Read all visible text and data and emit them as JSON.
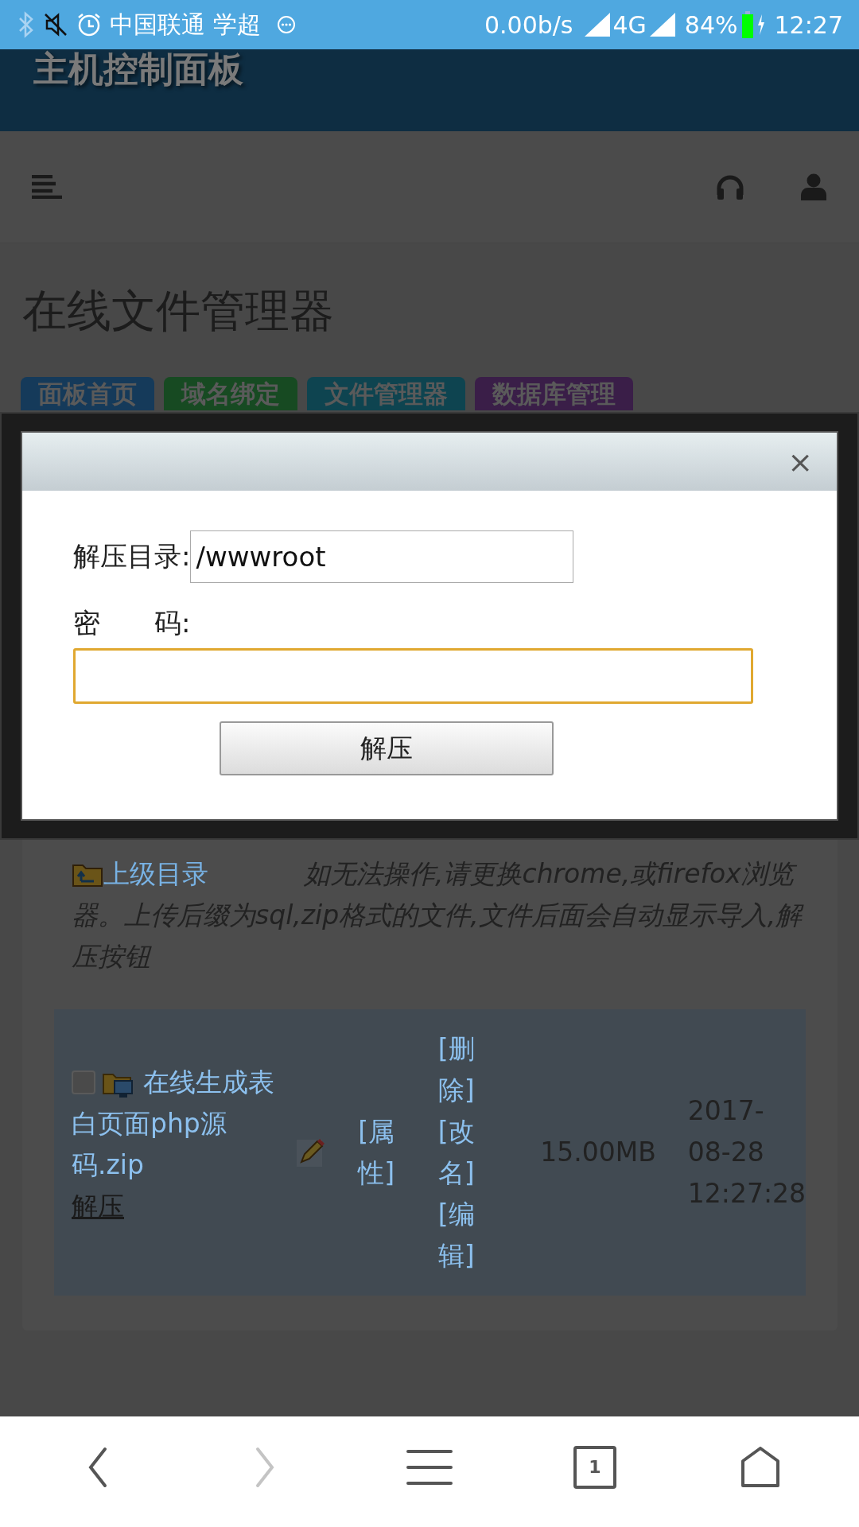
{
  "status_bar": {
    "carrier": "中国联通 学超",
    "speed": "0.00b/s",
    "network": "4G",
    "battery": "84%",
    "time": "12:27"
  },
  "header": {
    "title": "主机控制面板"
  },
  "page": {
    "title": "在线文件管理器",
    "tabs": [
      {
        "label": "面板首页",
        "color": "#153a5a"
      },
      {
        "label": "域名绑定",
        "color": "#174a22"
      },
      {
        "label": "文件管理器",
        "color": "#0e4450"
      },
      {
        "label": "数据库管理",
        "color": "#3a1e48"
      }
    ]
  },
  "file_manager": {
    "parent_link": "上级目录",
    "notice": "如无法操作,请更换chrome,或firefox浏览器。上传后缀为sql,zip格式的文件,文件后面会自动显示导入,解压按钮",
    "files": [
      {
        "name": "在线生成表白页面php源码.zip",
        "checked": false,
        "extract": "解压",
        "properties": "[属性]",
        "actions": [
          "[删除]",
          "[改名]",
          "[编辑]"
        ],
        "size": "15.00MB",
        "date": "2017-08-28 12:27:28"
      }
    ]
  },
  "dialog": {
    "close": "×",
    "fields": [
      {
        "kind": "text",
        "label": "解压目录:",
        "value": "/wwwroot",
        "focused": false
      },
      {
        "kind": "password",
        "label": "密　　码:",
        "focused": true
      }
    ],
    "button": "解压"
  },
  "nav_bar": [
    {
      "kind": "back",
      "disabled": false
    },
    {
      "kind": "forward",
      "disabled": true
    },
    {
      "kind": "menu",
      "disabled": false
    },
    {
      "kind": "tabs",
      "label": "1",
      "disabled": false
    },
    {
      "kind": "home",
      "disabled": false
    }
  ]
}
